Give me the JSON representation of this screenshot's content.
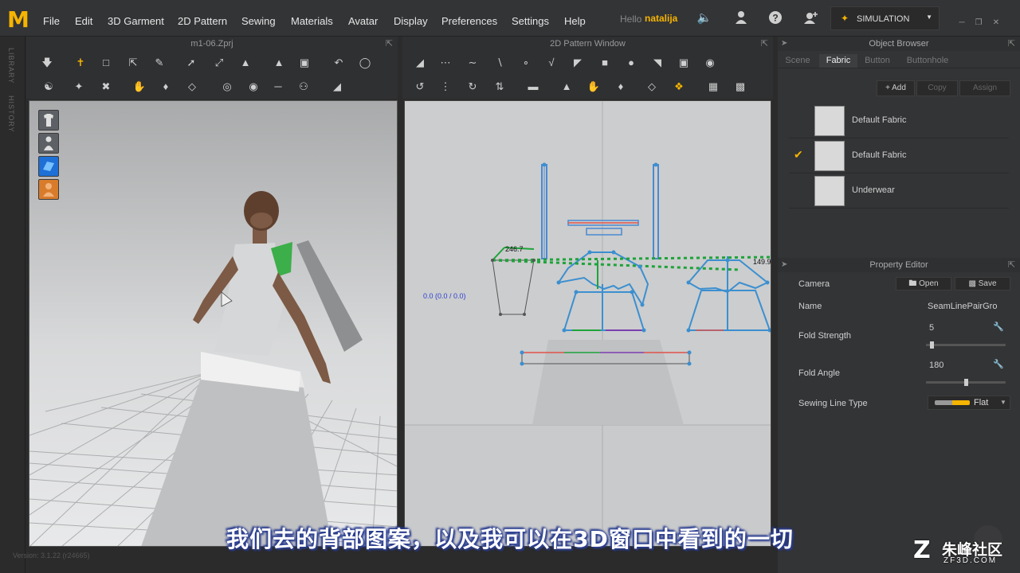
{
  "menu": {
    "logo": "M",
    "items": [
      "File",
      "Edit",
      "3D Garment",
      "2D Pattern",
      "Sewing",
      "Materials",
      "Avatar",
      "Display",
      "Preferences",
      "Settings",
      "Help"
    ],
    "hello": "Hello",
    "username": "natalija",
    "simulation_label": "SIMULATION"
  },
  "side_tabs": {
    "library": "LIBRARY",
    "history": "HISTORY"
  },
  "pane3d": {
    "title": "m1-06.Zprj"
  },
  "pane2d": {
    "title": "2D Pattern Window",
    "coord_readout": "0.0 (0.0 / 0.0)",
    "measure_a": "246.7",
    "measure_b": "149.9"
  },
  "object_browser": {
    "title": "Object Browser",
    "tabs": [
      "Scene",
      "Fabric",
      "Button",
      "Buttonhole"
    ],
    "active_tab": "Fabric",
    "add_label": "Add",
    "copy_label": "Copy",
    "assign_label": "Assign",
    "fabrics": [
      {
        "name": "Default Fabric",
        "checked": false
      },
      {
        "name": "Default Fabric",
        "checked": true
      },
      {
        "name": "Underwear",
        "checked": false
      }
    ]
  },
  "property_editor": {
    "title": "Property Editor",
    "camera_label": "Camera",
    "open_label": "Open",
    "save_label": "Save",
    "name_label": "Name",
    "name_value": "SeamLinePairGro",
    "fold_strength_label": "Fold Strength",
    "fold_strength_value": "5",
    "fold_strength_level": 0.05,
    "fold_angle_label": "Fold Angle",
    "fold_angle_value": "180",
    "fold_angle_level": 0.5,
    "sewing_line_type_label": "Sewing Line Type",
    "sewing_line_type_value": "Flat"
  },
  "subtitle": "我们去的背部图案，以及我可以在3D窗口中看到的一切",
  "version": "Version: 3.1.22     (r24665)",
  "watermark": {
    "cn": "朱峰社区",
    "url": "ZF3D.COM"
  },
  "colors": {
    "accent": "#f5b400",
    "seam_green": "#1ea33a",
    "seam_blue": "#3b8fd0",
    "seam_red": "#e0534a"
  }
}
